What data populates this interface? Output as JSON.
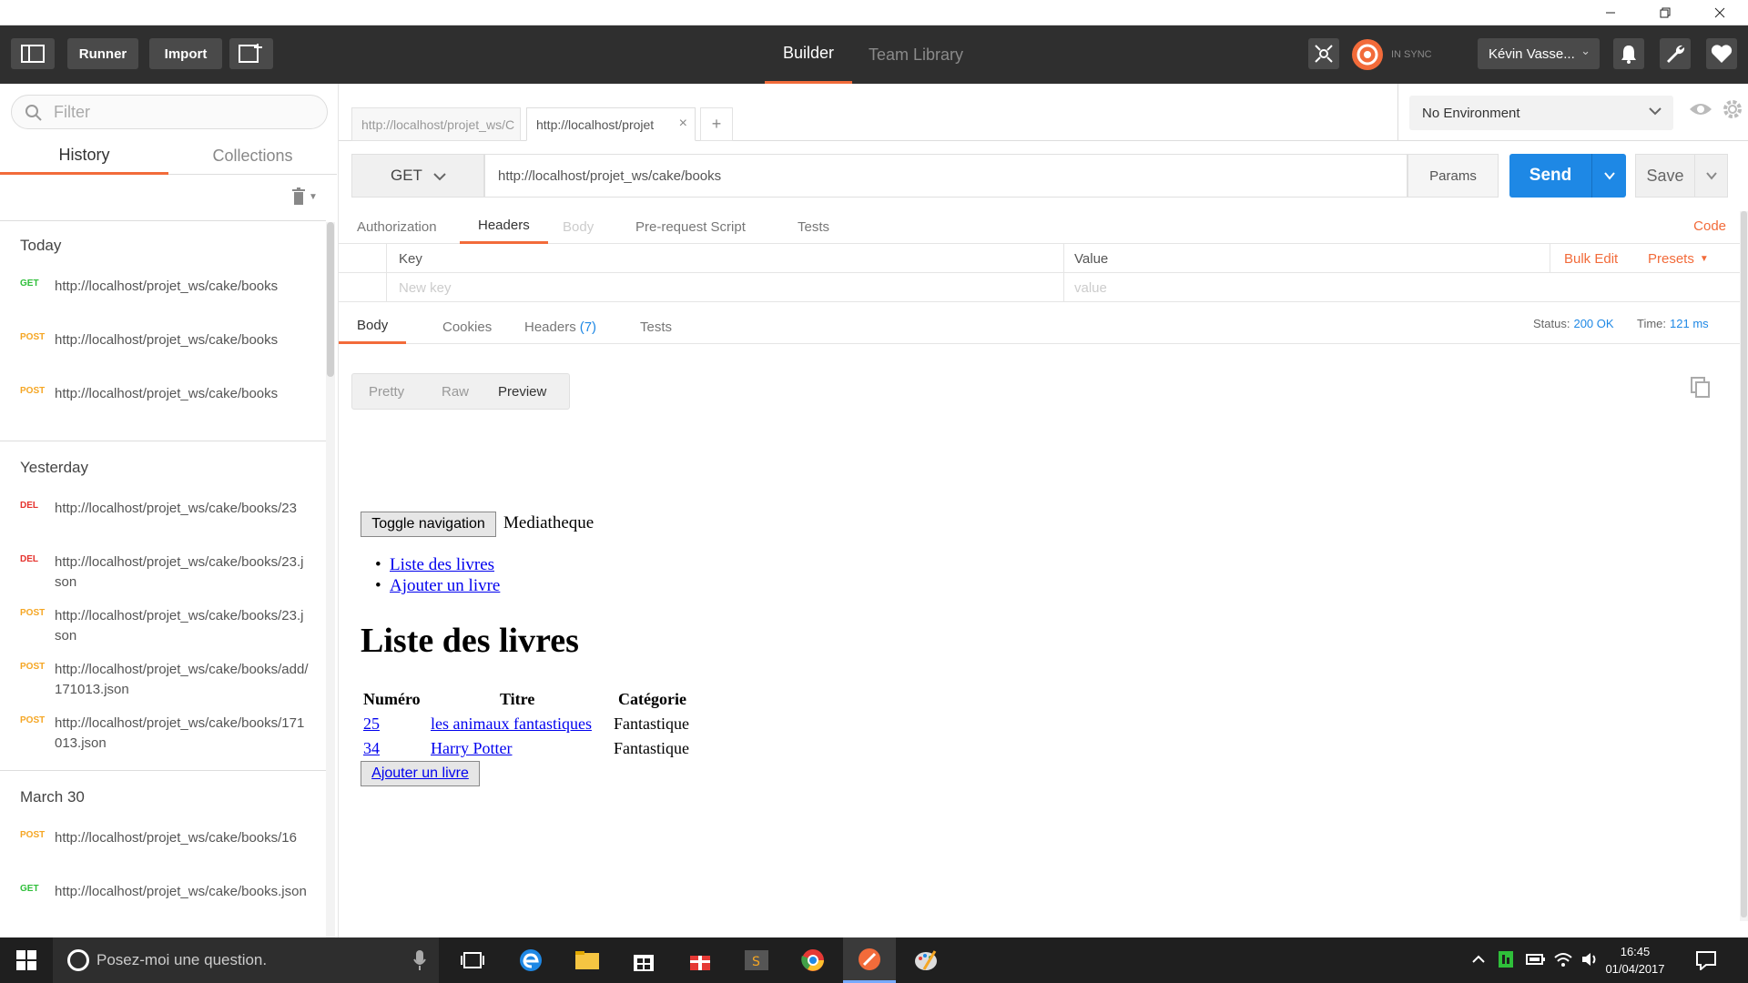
{
  "header": {
    "runner": "Runner",
    "import": "Import",
    "tab_builder": "Builder",
    "tab_team": "Team Library",
    "sync": "IN SYNC",
    "user": "Kévin Vasse..."
  },
  "sidebar": {
    "filter_placeholder": "Filter",
    "tab_history": "History",
    "tab_collections": "Collections",
    "groups": [
      {
        "label": "Today",
        "items": [
          {
            "method": "GET",
            "url": "http://localhost/projet_ws/cake/books"
          },
          {
            "method": "POST",
            "url": "http://localhost/projet_ws/cake/books"
          },
          {
            "method": "POST",
            "url": "http://localhost/projet_ws/cake/books"
          }
        ]
      },
      {
        "label": "Yesterday",
        "items": [
          {
            "method": "DEL",
            "url": "http://localhost/projet_ws/cake/books/23"
          },
          {
            "method": "DEL",
            "url": "http://localhost/projet_ws/cake/books/23.json"
          },
          {
            "method": "POST",
            "url": "http://localhost/projet_ws/cake/books/23.json"
          },
          {
            "method": "POST",
            "url": "http://localhost/projet_ws/cake/books/add/171013.json"
          },
          {
            "method": "POST",
            "url": "http://localhost/projet_ws/cake/books/171013.json"
          }
        ]
      },
      {
        "label": "March 30",
        "items": [
          {
            "method": "POST",
            "url": "http://localhost/projet_ws/cake/books/16"
          },
          {
            "method": "GET",
            "url": "http://localhost/projet_ws/cake/books.json"
          }
        ]
      }
    ]
  },
  "request": {
    "tabs": [
      {
        "label": "http://localhost/projet_ws/C"
      },
      {
        "label": "http://localhost/projet"
      }
    ],
    "add_tab": "+",
    "environment": "No Environment",
    "method": "GET",
    "url": "http://localhost/projet_ws/cake/books",
    "params": "Params",
    "send": "Send",
    "save": "Save",
    "subtabs": {
      "authorization": "Authorization",
      "headers": "Headers",
      "body": "Body",
      "prerequest": "Pre-request Script",
      "tests": "Tests"
    },
    "code": "Code",
    "headers_table": {
      "key": "Key",
      "value": "Value",
      "bulk_edit": "Bulk Edit",
      "presets": "Presets",
      "new_key_placeholder": "New key",
      "value_placeholder": "value"
    }
  },
  "response": {
    "tabs": {
      "body": "Body",
      "cookies": "Cookies",
      "headers": "Headers",
      "headers_count": "(7)",
      "tests": "Tests"
    },
    "status_label": "Status:",
    "status_value": "200 OK",
    "time_label": "Time:",
    "time_value": "121 ms",
    "views": {
      "pretty": "Pretty",
      "raw": "Raw",
      "preview": "Preview"
    }
  },
  "preview": {
    "toggle_nav": "Toggle navigation",
    "brand": "Mediatheque",
    "nav": [
      "Liste des livres",
      "Ajouter un livre"
    ],
    "heading": "Liste des livres",
    "table": {
      "headers": [
        "Numéro",
        "Titre",
        "Catégorie"
      ],
      "rows": [
        {
          "id": "25",
          "title": "les animaux fantastiques",
          "category": "Fantastique"
        },
        {
          "id": "34",
          "title": "Harry Potter",
          "category": "Fantastique"
        }
      ]
    },
    "add_button": "Ajouter un livre"
  },
  "taskbar": {
    "search": "Posez-moi une question.",
    "time": "16:45",
    "date": "01/04/2017"
  },
  "colors": {
    "accent": "#f26b3a",
    "send": "#1e88e5",
    "get": "#2fbf3a",
    "post": "#f5a623",
    "del": "#e5322d"
  }
}
